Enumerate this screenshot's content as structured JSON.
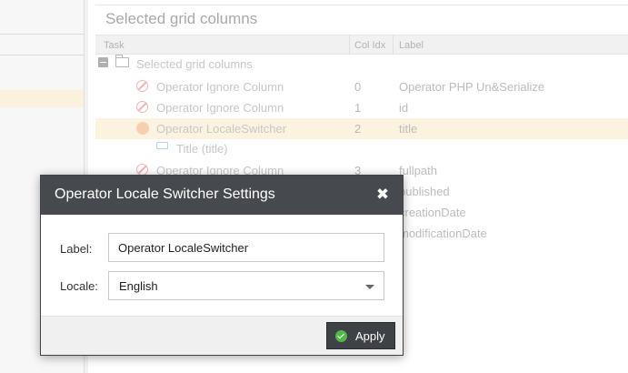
{
  "panel": {
    "title": "Selected grid columns",
    "columns": {
      "task": "Task",
      "col_idx": "Col Idx",
      "label": "Label"
    },
    "root_node": "Selected grid columns",
    "rows": [
      {
        "task": "Operator Ignore Column",
        "idx": "0",
        "label": "Operator PHP Un&Serialize",
        "icon": "ban-icon"
      },
      {
        "task": "Operator Ignore Column",
        "idx": "1",
        "label": "id",
        "icon": "ban-icon"
      },
      {
        "task": "Operator LocaleSwitcher",
        "idx": "2",
        "label": "title",
        "icon": "locale-icon",
        "selected": true
      },
      {
        "task": "Title (title)",
        "idx": "",
        "label": "",
        "icon": "field-tag-icon"
      },
      {
        "task": "Operator Ignore Column",
        "idx": "3",
        "label": "fullpath",
        "icon": "ban-icon"
      },
      {
        "task": "",
        "idx": "",
        "label": "published"
      },
      {
        "task": "",
        "idx": "",
        "label": "creationDate"
      },
      {
        "task": "",
        "idx": "",
        "label": "modificationDate"
      }
    ]
  },
  "dialog": {
    "title": "Operator Locale Switcher Settings",
    "close_icon": "close-icon",
    "label_field": {
      "label": "Label:",
      "value": "Operator LocaleSwitcher"
    },
    "locale_field": {
      "label": "Locale:",
      "value": "English"
    },
    "apply_label": "Apply"
  },
  "colors": {
    "dialog_header": "#464a4e",
    "apply_button": "#3e4246",
    "apply_check": "#52b84a",
    "selected_row": "#fbf3e0"
  }
}
